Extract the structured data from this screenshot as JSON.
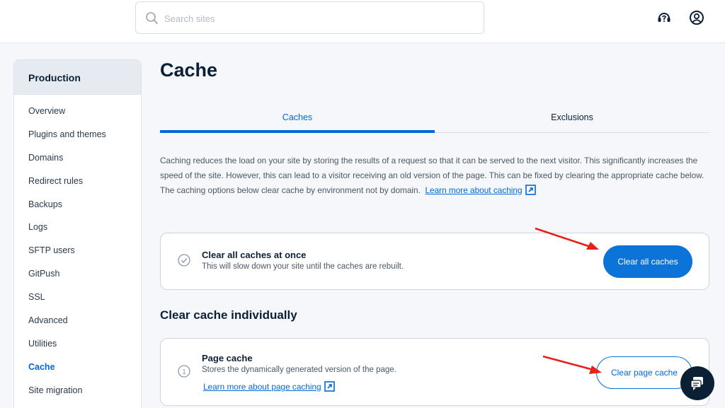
{
  "header": {
    "search_placeholder": "Search sites"
  },
  "sidebar": {
    "heading": "Production",
    "items": [
      {
        "label": "Overview"
      },
      {
        "label": "Plugins and themes"
      },
      {
        "label": "Domains"
      },
      {
        "label": "Redirect rules"
      },
      {
        "label": "Backups"
      },
      {
        "label": "Logs"
      },
      {
        "label": "SFTP users"
      },
      {
        "label": "GitPush"
      },
      {
        "label": "SSL"
      },
      {
        "label": "Advanced"
      },
      {
        "label": "Utilities"
      },
      {
        "label": "Cache"
      },
      {
        "label": "Site migration"
      }
    ],
    "active_item": "Cache"
  },
  "main": {
    "title": "Cache",
    "tabs": [
      {
        "label": "Caches",
        "selected": true
      },
      {
        "label": "Exclusions",
        "selected": false
      }
    ],
    "intro": {
      "text": "Caching reduces the load on your site by storing the results of a request so that it can be served to the next visitor. This significantly increases the speed of the site. However, this can lead to a visitor receiving an old version of the page. This can be fixed by clearing the appropriate cache below. The caching options below clear cache by environment not by domain.",
      "link": "Learn more about caching"
    },
    "clear_all": {
      "title": "Clear all caches at once",
      "description": "This will slow down your site until the caches are rebuilt.",
      "button": "Clear all caches"
    },
    "individual": {
      "heading": "Clear cache individually",
      "page_cache": {
        "number": "1",
        "title": "Page cache",
        "description": "Stores the dynamically generated version of the page.",
        "link": "Learn more about page caching",
        "button": "Clear page cache"
      }
    }
  },
  "colors": {
    "accent": "#0c74d8",
    "annotation_arrow": "#e8201a",
    "dark": "#0b2035"
  },
  "icons": [
    "search-icon",
    "help-icon",
    "account-icon",
    "check-circle-icon",
    "external-link-icon",
    "chat-icon"
  ]
}
